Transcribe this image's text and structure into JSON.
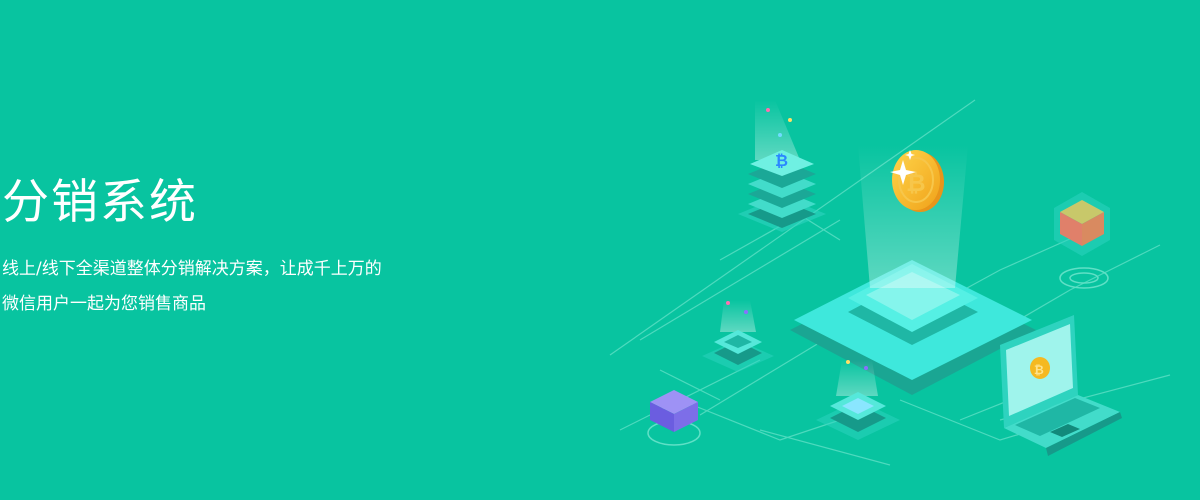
{
  "hero": {
    "title": "分销系统",
    "description_line1": "线上/线下全渠道整体分销解决方案，让成千上万的",
    "description_line2": "微信用户一起为您销售商品"
  },
  "colors": {
    "background": "#08c4a0",
    "platform": "#3ee8dc",
    "coin": "#f5b921",
    "cube_purple": "#7d6ee8",
    "cube_orange": "#e8905a"
  },
  "illustration": {
    "coin_icon": "bitcoin-icon"
  }
}
